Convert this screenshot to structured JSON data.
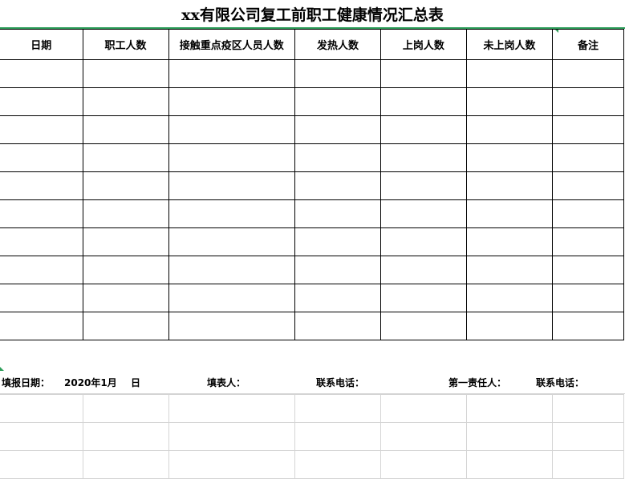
{
  "title": "xx有限公司复工前职工健康情况汇总表",
  "colors": {
    "accent": "#2e9e5a",
    "grid": "#000000",
    "sheet_grid": "#d4d4d4"
  },
  "table": {
    "headers": [
      "日期",
      "职工人数",
      "接触重点疫区人员人数",
      "发热人数",
      "上岗人数",
      "未上岗人数",
      "备注"
    ],
    "rows": [
      [
        "",
        "",
        "",
        "",
        "",
        "",
        ""
      ],
      [
        "",
        "",
        "",
        "",
        "",
        "",
        ""
      ],
      [
        "",
        "",
        "",
        "",
        "",
        "",
        ""
      ],
      [
        "",
        "",
        "",
        "",
        "",
        "",
        ""
      ],
      [
        "",
        "",
        "",
        "",
        "",
        "",
        ""
      ],
      [
        "",
        "",
        "",
        "",
        "",
        "",
        ""
      ],
      [
        "",
        "",
        "",
        "",
        "",
        "",
        ""
      ],
      [
        "",
        "",
        "",
        "",
        "",
        "",
        ""
      ],
      [
        "",
        "",
        "",
        "",
        "",
        "",
        ""
      ],
      [
        "",
        "",
        "",
        "",
        "",
        "",
        ""
      ]
    ]
  },
  "footer": {
    "report_date_label": "填报日期：",
    "report_date_value": "2020年1月",
    "day_label": "日",
    "filler_label": "填表人：",
    "phone_label_1": "联系电话：",
    "responsible_label": "第一责任人：",
    "phone_label_2": "联系电话："
  }
}
